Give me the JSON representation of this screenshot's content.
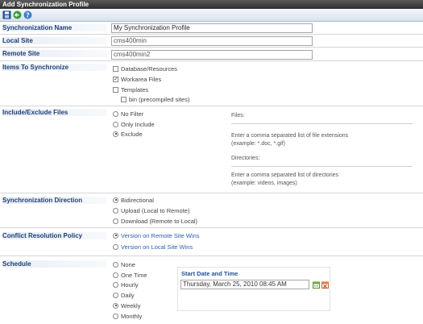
{
  "window": {
    "title": "Add Synchronization Profile"
  },
  "toolbar": {
    "buttons": [
      "save-icon",
      "back-icon",
      "help-icon"
    ]
  },
  "profile": {
    "label": "Synchronization Name",
    "value": "My Synchronization Profile"
  },
  "local_site": {
    "label": "Local Site",
    "value": "cms400min"
  },
  "remote_site": {
    "label": "Remote Site",
    "value": "cms400min2"
  },
  "items": {
    "label": "Items To Synchronize",
    "options": [
      {
        "text": "Database/Resources",
        "checked": false
      },
      {
        "text": "Workarea Files",
        "checked": true
      },
      {
        "text": "Templates",
        "checked": false
      },
      {
        "text": "bin (precompiled sites)",
        "checked": false
      }
    ]
  },
  "include": {
    "label": "Include/Exclude Files",
    "options": [
      "No Filter",
      "Only Include",
      "Exclude"
    ],
    "selected": "Exclude",
    "files_label": "Files:",
    "files_hint_1": "Enter a comma separated list of file extensions",
    "files_hint_2": "(example: *.doc, *.gif)",
    "dirs_label": "Directories:",
    "dirs_hint_1": "Enter a comma separated list of directories",
    "dirs_hint_2": "(example: videos, images)"
  },
  "direction": {
    "label": "Synchronization Direction",
    "options": [
      "Bidirectional",
      "Upload (Local to Remote)",
      "Download (Remote to Local)"
    ],
    "selected": "Bidirectional"
  },
  "conflict": {
    "label": "Conflict Resolution Policy",
    "options": [
      "Version on Remote Site Wins",
      "Version on Local Site Wins"
    ],
    "selected": "Version on Remote Site Wins"
  },
  "schedule": {
    "label": "Schedule",
    "options": [
      "None",
      "One Time",
      "Hourly",
      "Daily",
      "Weekly",
      "Monthly"
    ],
    "selected": "Weekly",
    "start_title": "Start Date and Time",
    "start_value": "Thursday, March 25, 2010 08:45 AM"
  }
}
